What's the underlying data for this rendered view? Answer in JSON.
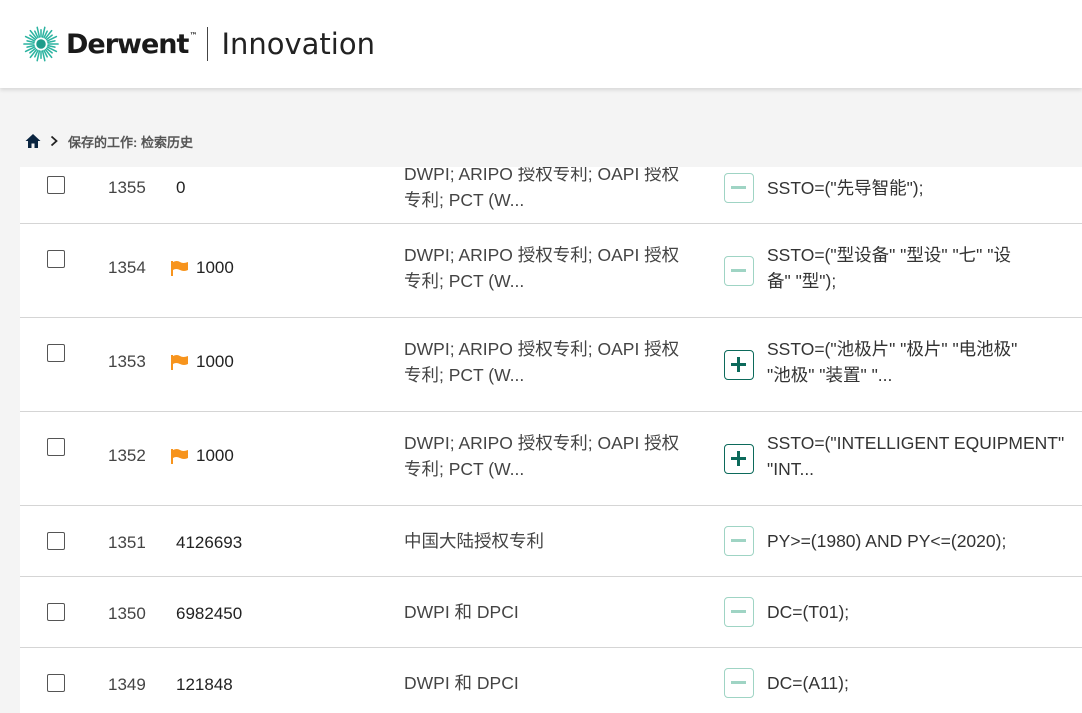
{
  "header": {
    "brand": "Derwent",
    "trademark": "™",
    "product": "Innovation"
  },
  "breadcrumb": {
    "home_icon": "home-icon",
    "separator_icon": "chevron-right-icon",
    "current": "保存的工作: 检索历史"
  },
  "colors": {
    "flag": "#f7941d",
    "toggle_minus": "#9fd4c4",
    "toggle_plus": "#0c6a5b"
  },
  "rows": [
    {
      "id": "1355",
      "count": "0",
      "flagged": false,
      "db_line1": "DWPI; ARIPO 授权专利; OAPI 授权",
      "db_line2": "专利; PCT (W...",
      "toggle": "minus",
      "q_line1": "SSTO=(\"先导智能\");",
      "q_line2": ""
    },
    {
      "id": "1354",
      "count": "1000",
      "flagged": true,
      "db_line1": "DWPI; ARIPO 授权专利; OAPI 授权",
      "db_line2": "专利; PCT (W...",
      "toggle": "minus",
      "q_line1": "SSTO=(\"型设备\" \"型设\" \"七\" \"设",
      "q_line2": "备\" \"型\");"
    },
    {
      "id": "1353",
      "count": "1000",
      "flagged": true,
      "db_line1": "DWPI; ARIPO 授权专利; OAPI 授权",
      "db_line2": "专利; PCT (W...",
      "toggle": "plus",
      "q_line1": "SSTO=(\"池极片\" \"极片\" \"电池极\"",
      "q_line2": "\"池极\" \"装置\" \"..."
    },
    {
      "id": "1352",
      "count": "1000",
      "flagged": true,
      "db_line1": "DWPI; ARIPO 授权专利; OAPI 授权",
      "db_line2": "专利; PCT (W...",
      "toggle": "plus",
      "q_line1": "SSTO=(\"INTELLIGENT EQUIPMENT\"",
      "q_line2": "\"INT..."
    },
    {
      "id": "1351",
      "count": "4126693",
      "flagged": false,
      "db_line1": "中国大陆授权专利",
      "db_line2": "",
      "toggle": "minus",
      "q_line1": "PY>=(1980) AND PY<=(2020);",
      "q_line2": ""
    },
    {
      "id": "1350",
      "count": "6982450",
      "flagged": false,
      "db_line1": "DWPI 和 DPCI",
      "db_line2": "",
      "toggle": "minus",
      "q_line1": "DC=(T01);",
      "q_line2": ""
    },
    {
      "id": "1349",
      "count": "121848",
      "flagged": false,
      "db_line1": "DWPI 和 DPCI",
      "db_line2": "",
      "toggle": "minus",
      "q_line1": "DC=(A11);",
      "q_line2": ""
    }
  ]
}
